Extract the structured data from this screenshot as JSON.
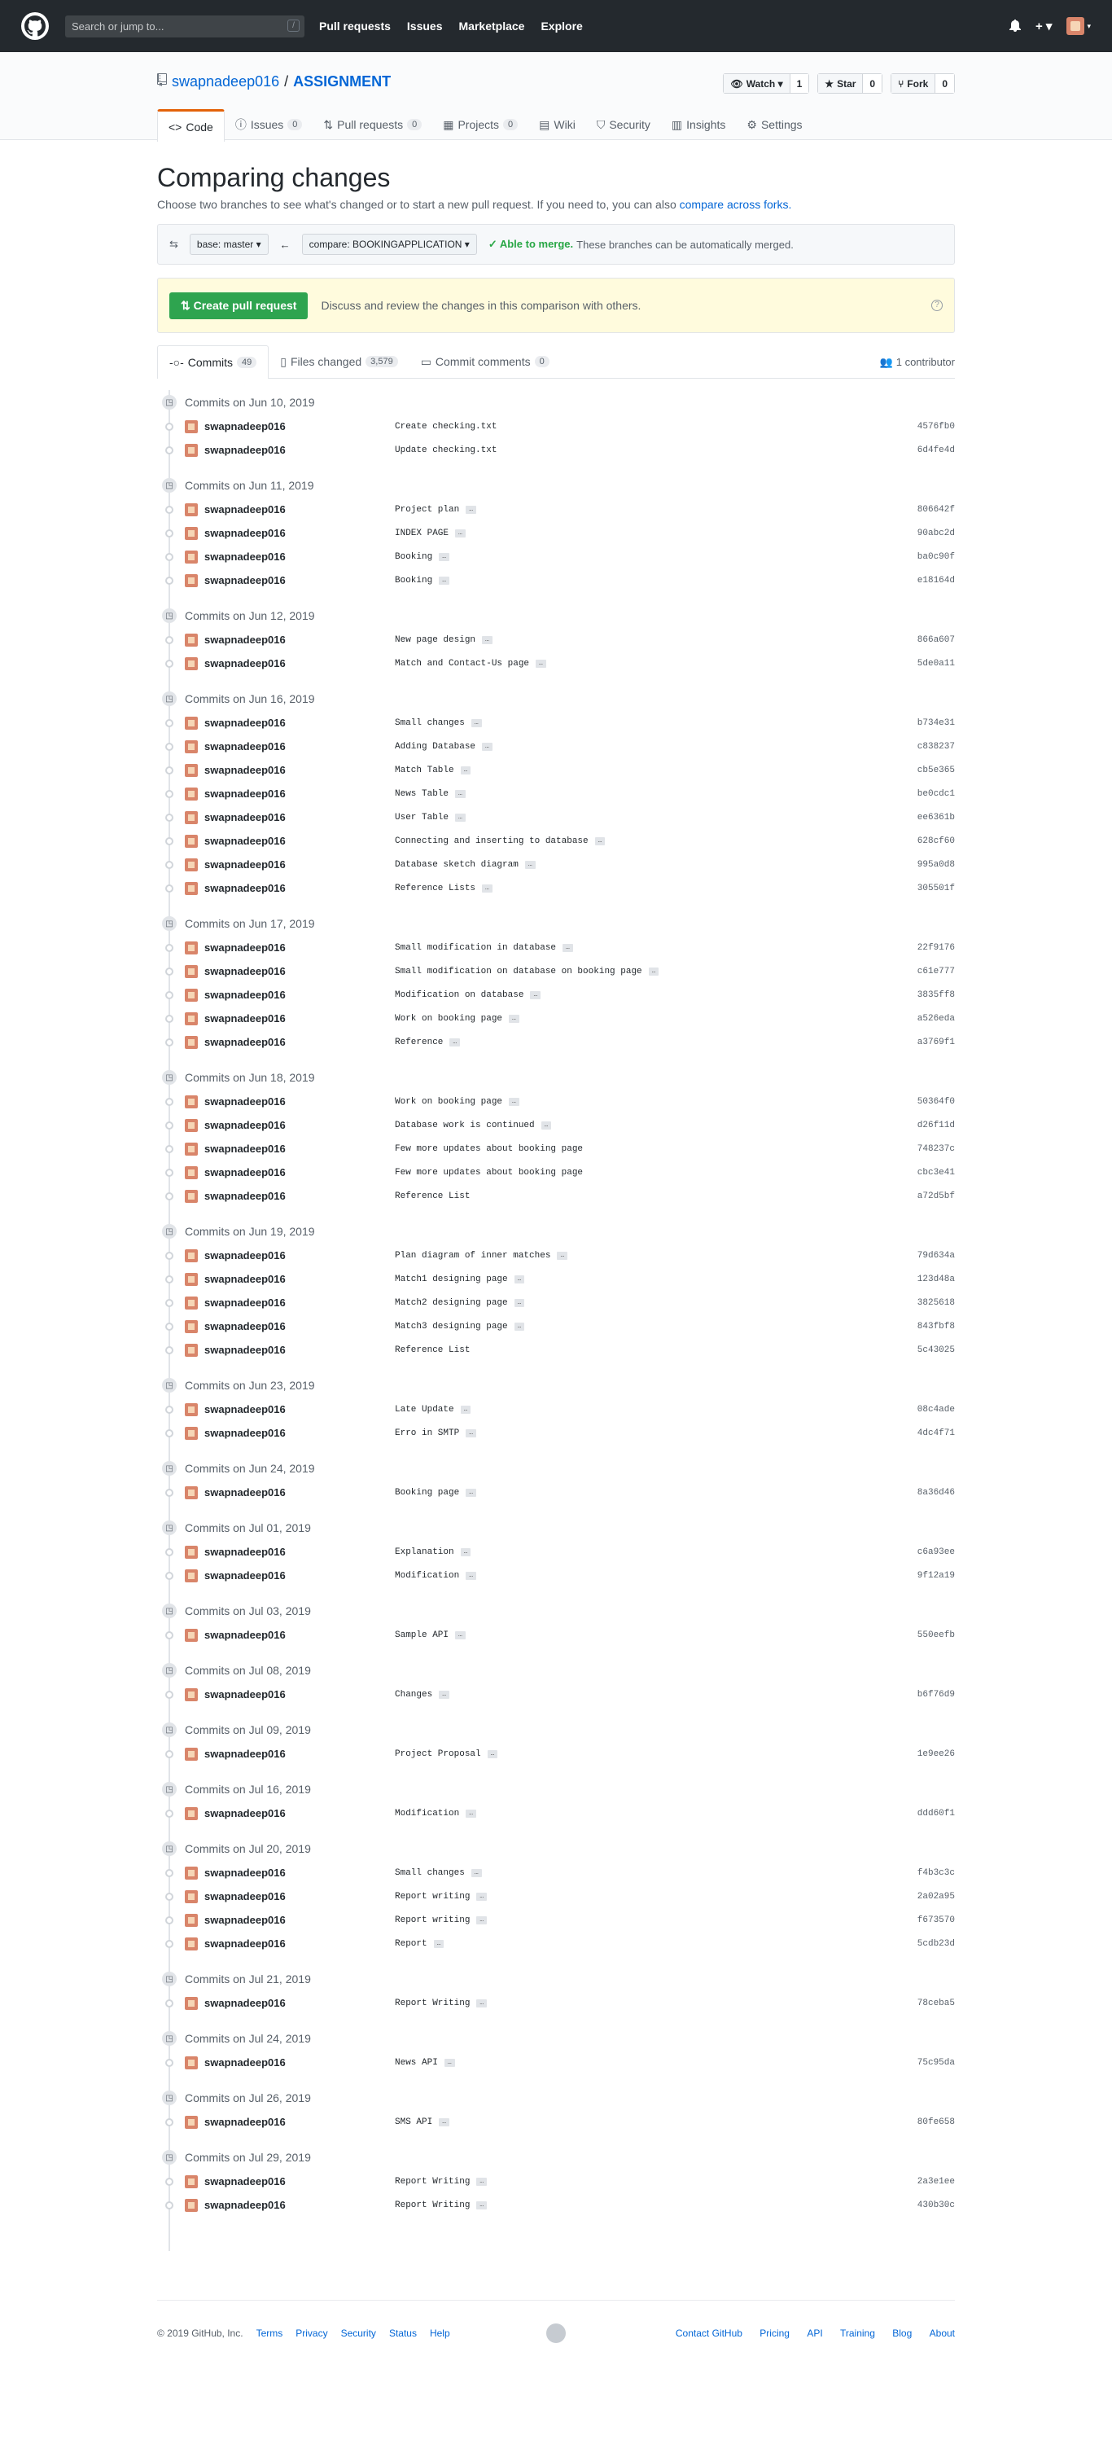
{
  "header": {
    "search_placeholder": "Search or jump to...",
    "slash": "/",
    "nav": [
      "Pull requests",
      "Issues",
      "Marketplace",
      "Explore"
    ],
    "plus": "+ ▾"
  },
  "repo": {
    "owner": "swapnadeep016",
    "sep": "/",
    "name": "ASSIGNMENT",
    "watch": "Watch ▾",
    "watch_count": "1",
    "star": "Star",
    "star_count": "0",
    "fork": "Fork",
    "fork_count": "0",
    "tabs": [
      {
        "label": "Code",
        "count": ""
      },
      {
        "label": "Issues",
        "count": "0"
      },
      {
        "label": "Pull requests",
        "count": "0"
      },
      {
        "label": "Projects",
        "count": "0"
      },
      {
        "label": "Wiki",
        "count": ""
      },
      {
        "label": "Security",
        "count": ""
      },
      {
        "label": "Insights",
        "count": ""
      },
      {
        "label": "Settings",
        "count": ""
      }
    ]
  },
  "compare": {
    "title": "Comparing changes",
    "subtitle": "Choose two branches to see what's changed or to start a new pull request. If you need to, you can also",
    "subtitle_link": "compare across forks.",
    "base": "base: master ▾",
    "arrow": "←",
    "head": "compare: BOOKINGAPPLICATION ▾",
    "able": "✓ Able to merge.",
    "able_text": "These branches can be automatically merged.",
    "pr_button": "Create pull request",
    "pr_text": "Discuss and review the changes in this comparison with others.",
    "help": "?"
  },
  "subtabs": [
    {
      "label": "Commits",
      "count": "49"
    },
    {
      "label": "Files changed",
      "count": "3,579"
    },
    {
      "label": "Commit comments",
      "count": "0"
    }
  ],
  "contributors": "1 contributor",
  "groups": [
    {
      "date": "Commits on Jun 10, 2019",
      "commits": [
        {
          "author": "swapnadeep016",
          "msg": "Create checking.txt",
          "ell": false,
          "sha": "4576fb0"
        },
        {
          "author": "swapnadeep016",
          "msg": "Update checking.txt",
          "ell": false,
          "sha": "6d4fe4d"
        }
      ]
    },
    {
      "date": "Commits on Jun 11, 2019",
      "commits": [
        {
          "author": "swapnadeep016",
          "msg": "Project plan",
          "ell": true,
          "sha": "806642f"
        },
        {
          "author": "swapnadeep016",
          "msg": "INDEX PAGE",
          "ell": true,
          "sha": "90abc2d"
        },
        {
          "author": "swapnadeep016",
          "msg": "Booking",
          "ell": true,
          "sha": "ba0c90f"
        },
        {
          "author": "swapnadeep016",
          "msg": "Booking",
          "ell": true,
          "sha": "e18164d"
        }
      ]
    },
    {
      "date": "Commits on Jun 12, 2019",
      "commits": [
        {
          "author": "swapnadeep016",
          "msg": "New page design",
          "ell": true,
          "sha": "866a607"
        },
        {
          "author": "swapnadeep016",
          "msg": "Match and Contact-Us page",
          "ell": true,
          "sha": "5de0a11"
        }
      ]
    },
    {
      "date": "Commits on Jun 16, 2019",
      "commits": [
        {
          "author": "swapnadeep016",
          "msg": "Small changes",
          "ell": true,
          "sha": "b734e31"
        },
        {
          "author": "swapnadeep016",
          "msg": "Adding Database",
          "ell": true,
          "sha": "c838237"
        },
        {
          "author": "swapnadeep016",
          "msg": "Match Table",
          "ell": true,
          "sha": "cb5e365"
        },
        {
          "author": "swapnadeep016",
          "msg": "News Table",
          "ell": true,
          "sha": "be0cdc1"
        },
        {
          "author": "swapnadeep016",
          "msg": "User Table",
          "ell": true,
          "sha": "ee6361b"
        },
        {
          "author": "swapnadeep016",
          "msg": "Connecting and inserting to database",
          "ell": true,
          "sha": "628cf60"
        },
        {
          "author": "swapnadeep016",
          "msg": "Database sketch diagram",
          "ell": true,
          "sha": "995a0d8"
        },
        {
          "author": "swapnadeep016",
          "msg": "Reference Lists",
          "ell": true,
          "sha": "305501f"
        }
      ]
    },
    {
      "date": "Commits on Jun 17, 2019",
      "commits": [
        {
          "author": "swapnadeep016",
          "msg": "Small modification in database",
          "ell": true,
          "sha": "22f9176"
        },
        {
          "author": "swapnadeep016",
          "msg": "Small modification on database on booking page",
          "ell": true,
          "sha": "c61e777"
        },
        {
          "author": "swapnadeep016",
          "msg": "Modification on database",
          "ell": true,
          "sha": "3835ff8"
        },
        {
          "author": "swapnadeep016",
          "msg": "Work on booking page",
          "ell": true,
          "sha": "a526eda"
        },
        {
          "author": "swapnadeep016",
          "msg": "Reference",
          "ell": true,
          "sha": "a3769f1"
        }
      ]
    },
    {
      "date": "Commits on Jun 18, 2019",
      "commits": [
        {
          "author": "swapnadeep016",
          "msg": "Work on booking page",
          "ell": true,
          "sha": "50364f0"
        },
        {
          "author": "swapnadeep016",
          "msg": "Database work is continued",
          "ell": true,
          "sha": "d26f11d"
        },
        {
          "author": "swapnadeep016",
          "msg": "Few more updates about booking page",
          "ell": false,
          "sha": "748237c"
        },
        {
          "author": "swapnadeep016",
          "msg": "Few more updates about booking page",
          "ell": false,
          "sha": "cbc3e41"
        },
        {
          "author": "swapnadeep016",
          "msg": "Reference List",
          "ell": false,
          "sha": "a72d5bf"
        }
      ]
    },
    {
      "date": "Commits on Jun 19, 2019",
      "commits": [
        {
          "author": "swapnadeep016",
          "msg": "Plan diagram of inner matches",
          "ell": true,
          "sha": "79d634a"
        },
        {
          "author": "swapnadeep016",
          "msg": "Match1 designing page",
          "ell": true,
          "sha": "123d48a"
        },
        {
          "author": "swapnadeep016",
          "msg": "Match2 designing page",
          "ell": true,
          "sha": "3825618"
        },
        {
          "author": "swapnadeep016",
          "msg": "Match3 designing page",
          "ell": true,
          "sha": "843fbf8"
        },
        {
          "author": "swapnadeep016",
          "msg": "Reference List",
          "ell": false,
          "sha": "5c43025"
        }
      ]
    },
    {
      "date": "Commits on Jun 23, 2019",
      "commits": [
        {
          "author": "swapnadeep016",
          "msg": "Late Update",
          "ell": true,
          "sha": "08c4ade"
        },
        {
          "author": "swapnadeep016",
          "msg": "Erro in SMTP",
          "ell": true,
          "sha": "4dc4f71"
        }
      ]
    },
    {
      "date": "Commits on Jun 24, 2019",
      "commits": [
        {
          "author": "swapnadeep016",
          "msg": "Booking page",
          "ell": true,
          "sha": "8a36d46"
        }
      ]
    },
    {
      "date": "Commits on Jul 01, 2019",
      "commits": [
        {
          "author": "swapnadeep016",
          "msg": "Explanation",
          "ell": true,
          "sha": "c6a93ee"
        },
        {
          "author": "swapnadeep016",
          "msg": "Modification",
          "ell": true,
          "sha": "9f12a19"
        }
      ]
    },
    {
      "date": "Commits on Jul 03, 2019",
      "commits": [
        {
          "author": "swapnadeep016",
          "msg": "Sample API",
          "ell": true,
          "sha": "550eefb"
        }
      ]
    },
    {
      "date": "Commits on Jul 08, 2019",
      "commits": [
        {
          "author": "swapnadeep016",
          "msg": "Changes",
          "ell": true,
          "sha": "b6f76d9"
        }
      ]
    },
    {
      "date": "Commits on Jul 09, 2019",
      "commits": [
        {
          "author": "swapnadeep016",
          "msg": "Project Proposal",
          "ell": true,
          "sha": "1e9ee26"
        }
      ]
    },
    {
      "date": "Commits on Jul 16, 2019",
      "commits": [
        {
          "author": "swapnadeep016",
          "msg": "Modification",
          "ell": true,
          "sha": "ddd60f1"
        }
      ]
    },
    {
      "date": "Commits on Jul 20, 2019",
      "commits": [
        {
          "author": "swapnadeep016",
          "msg": "Small changes",
          "ell": true,
          "sha": "f4b3c3c"
        },
        {
          "author": "swapnadeep016",
          "msg": "Report writing",
          "ell": true,
          "sha": "2a02a95"
        },
        {
          "author": "swapnadeep016",
          "msg": "Report writing",
          "ell": true,
          "sha": "f673570"
        },
        {
          "author": "swapnadeep016",
          "msg": "Report",
          "ell": true,
          "sha": "5cdb23d"
        }
      ]
    },
    {
      "date": "Commits on Jul 21, 2019",
      "commits": [
        {
          "author": "swapnadeep016",
          "msg": "Report Writing",
          "ell": true,
          "sha": "78ceba5"
        }
      ]
    },
    {
      "date": "Commits on Jul 24, 2019",
      "commits": [
        {
          "author": "swapnadeep016",
          "msg": "News API",
          "ell": true,
          "sha": "75c95da"
        }
      ]
    },
    {
      "date": "Commits on Jul 26, 2019",
      "commits": [
        {
          "author": "swapnadeep016",
          "msg": "SMS API",
          "ell": true,
          "sha": "80fe658"
        }
      ]
    },
    {
      "date": "Commits on Jul 29, 2019",
      "commits": [
        {
          "author": "swapnadeep016",
          "msg": "Report Writing",
          "ell": true,
          "sha": "2a3e1ee"
        },
        {
          "author": "swapnadeep016",
          "msg": "Report Writing",
          "ell": true,
          "sha": "430b30c"
        }
      ]
    }
  ],
  "ellipsis": "…",
  "footer": {
    "copyright": "© 2019 GitHub, Inc.",
    "left": [
      "Terms",
      "Privacy",
      "Security",
      "Status",
      "Help"
    ],
    "right": [
      "Contact GitHub",
      "Pricing",
      "API",
      "Training",
      "Blog",
      "About"
    ]
  }
}
